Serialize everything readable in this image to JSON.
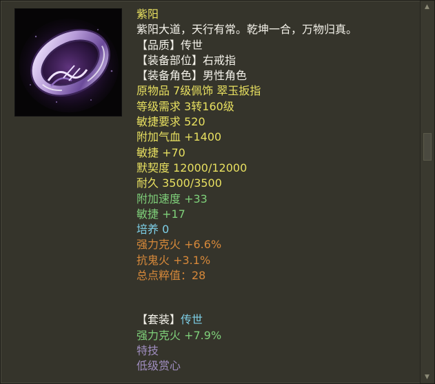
{
  "colors": {
    "panel_bg": "#35342b",
    "yellow": "#e8e060",
    "white": "#f4f2ea",
    "green": "#7fd07a",
    "cyan": "#7ed0e8",
    "orange": "#d7893a",
    "purple": "#a08ec0"
  },
  "item": {
    "icon": "purple-ring-icon",
    "name": "紫阳",
    "description": "紫阳大道，天行有常。乾坤一合，万物归真。",
    "quality": "【品质】传世",
    "slot": "【装备部位】右戒指",
    "role": "【装备角色】男性角色",
    "origin": "原物品 7级佩饰 翠玉扳指",
    "level_req": "等级需求 3转160级",
    "agility_req": "敏捷要求 520",
    "hp_bonus": "附加气血 +1400",
    "agility": "敏捷 +70",
    "tacit": "默契度 12000/12000",
    "durability": "耐久 3500/3500",
    "speed_bonus": "附加速度 +33",
    "agility_bonus": "敏捷 +17",
    "cultivate": "培养 0",
    "strong_vs_fire": "强力克火 +6.6%",
    "resist_ghost_fire": "抗鬼火 +3.1%",
    "total_purity": "总点粹值：28"
  },
  "set": {
    "label": "【套装】",
    "name": "传世",
    "bonus": "强力克火 +7.9%",
    "skill_label": "特技",
    "skill_name": "低级赏心"
  }
}
